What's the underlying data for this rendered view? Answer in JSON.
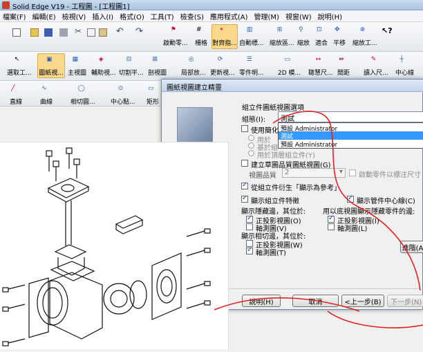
{
  "window": {
    "title": "Solid Edge V19 - 工程圖 - [工程圖1]"
  },
  "menu": [
    "檔案(F)",
    "編輯(E)",
    "檢視(V)",
    "插入(I)",
    "格式(O)",
    "工具(T)",
    "檢查(S)",
    "應用程式(A)",
    "管理(M)",
    "視窗(W)",
    "說明(H)"
  ],
  "toolbar1": [
    "啟動零...",
    "柵格",
    "對齊指...",
    "自動標...",
    "縮放區...",
    "縮放",
    "適合",
    "平移",
    "縮放工..."
  ],
  "toolbar2": [
    "選取工...",
    "圖紙視...",
    "主視圖",
    "輔助視...",
    "切割平...",
    "剖視圖",
    "局部放...",
    "更新視...",
    "零件明...",
    "2D 模...",
    "聰慧尺...",
    "間距",
    "讀入尺...",
    "中心線"
  ],
  "toolbar3": [
    "直線",
    "曲線",
    "相切圓...",
    "中心點...",
    "矩形"
  ],
  "dialog": {
    "title": "圖紙視圖建立精靈",
    "section_heading": "組立件圖紙視圖選項",
    "group_label": "組態(I):",
    "group_value": "測試",
    "dropdown_options": [
      "預設 Administrator",
      "測試",
      "預設 Administrator"
    ],
    "simplified_label": "使用簡化",
    "assembly_label": "基於組",
    "radio_third": "用於頂層組立件(Y)",
    "radio_first": "用於",
    "quality_check_label": "建立草圖品質圖紙視圖(G)",
    "quality_label": "視圖品質",
    "quality_value": "2",
    "quality_hint": "啟動零件以標注尺寸",
    "derive_label": "從組立件衍生「顯示為參考」",
    "show_features": "顯示組立件特徵",
    "show_centerline": "顯示管件中心線(C)",
    "edges_heading": "顯示隱藏邊，其位於:",
    "edges_hidden_heading": "用以底視圖顯示隱藏零件的邊:",
    "edges_left": [
      "正投影視圖(O)",
      "軸測圖(V)"
    ],
    "edges_right": [
      "正投影視圖(I)",
      "軸測圖(L)"
    ],
    "tangent_heading": "顯示相切邊，其位於:",
    "tangent_items": [
      "正投影視圖(W)",
      "軸測圖(T)"
    ],
    "advanced_button": "進階(A)",
    "buttons": {
      "help": "說明(H)",
      "cancel": "取消",
      "back": "<上一步(B)",
      "next": "下一步(N) >"
    }
  }
}
